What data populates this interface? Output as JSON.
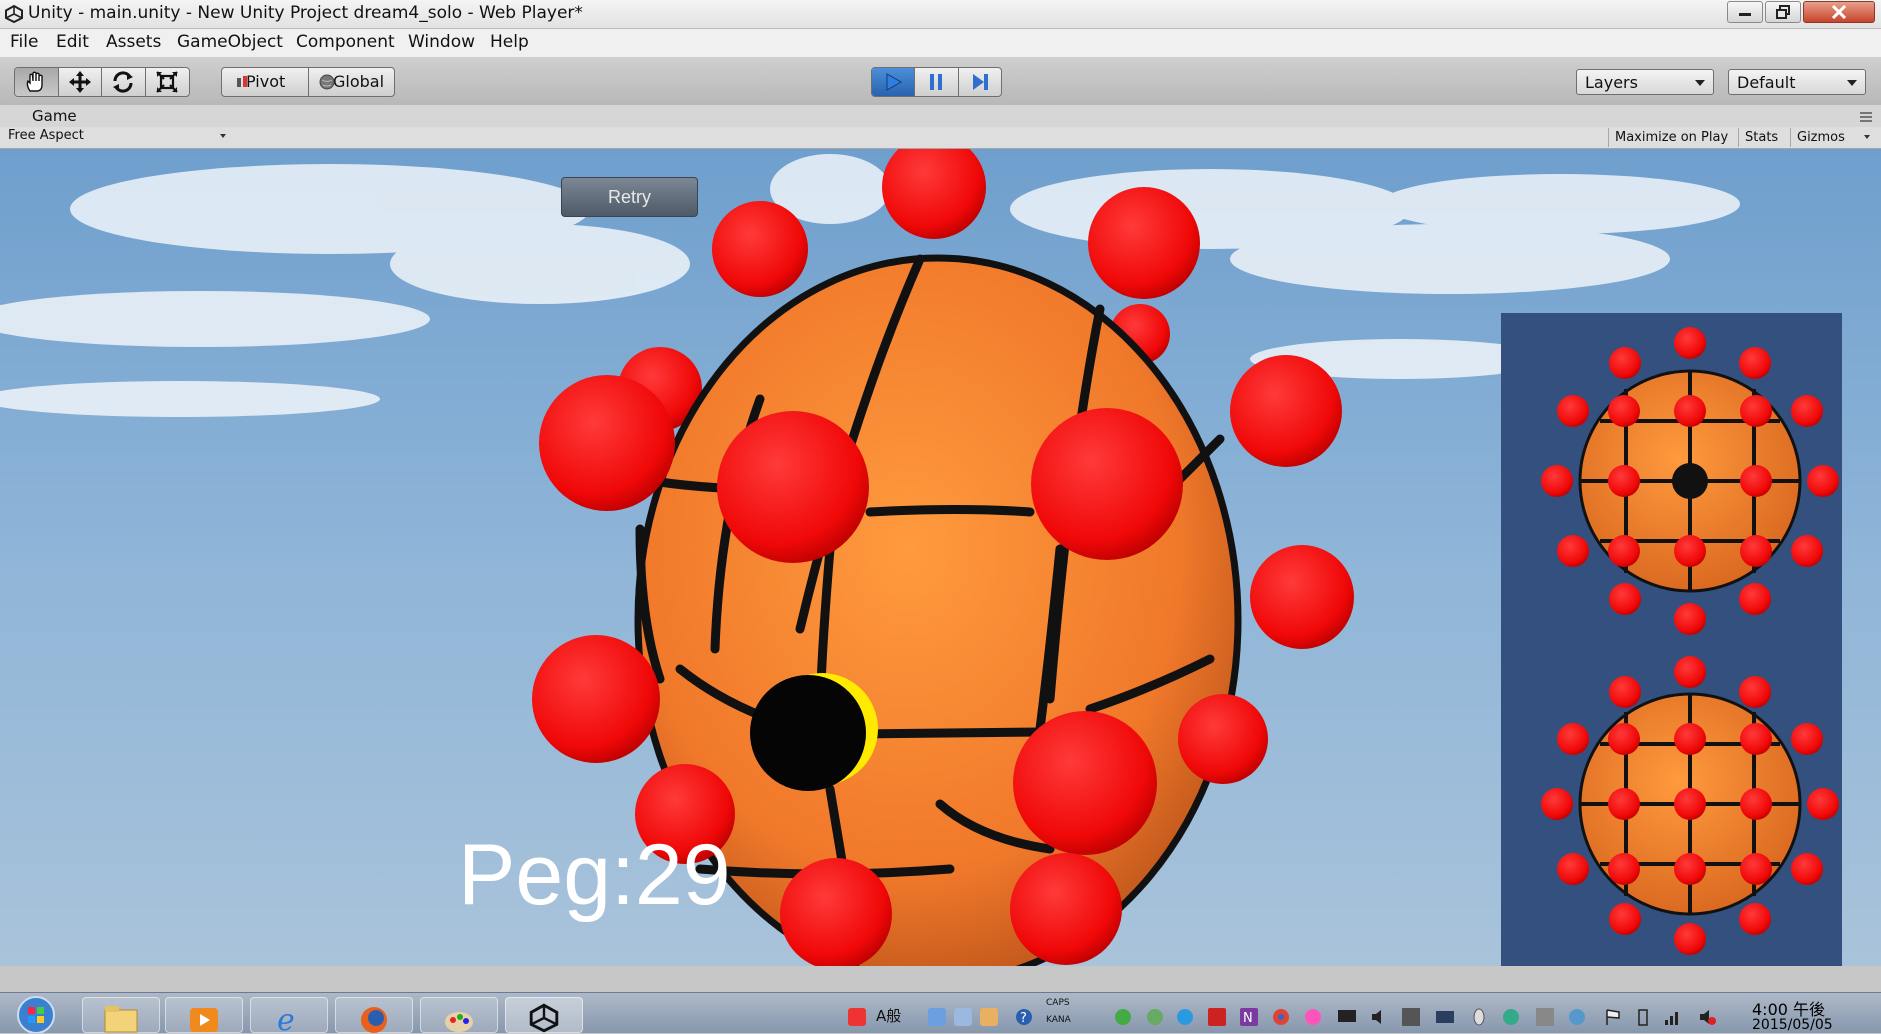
{
  "window": {
    "title": "Unity - main.unity - New Unity Project dream4_solo - Web Player*"
  },
  "menu": {
    "items": [
      "File",
      "Edit",
      "Assets",
      "GameObject",
      "Component",
      "Window",
      "Help"
    ]
  },
  "toolbar": {
    "pivot_label": "Pivot",
    "global_label": "Global",
    "layers_label": "Layers",
    "layout_label": "Default"
  },
  "game_panel": {
    "tab_label": "Game",
    "aspect_label": "Free Aspect",
    "maximize_label": "Maximize on Play",
    "stats_label": "Stats",
    "gizmos_label": "Gizmos"
  },
  "game": {
    "retry_label": "Retry",
    "peg_label": "Peg:29"
  },
  "taskbar": {
    "time": "4:00 午後",
    "date": "2015/05/05",
    "ime_caps": "CAPS",
    "ime_kana": "KANA",
    "ime_mode": "A般"
  },
  "colors": {
    "ball": "#f0782a",
    "peg": "#ff1010",
    "minimap_bg": "#33507e",
    "play_active": "#2a62b0"
  }
}
